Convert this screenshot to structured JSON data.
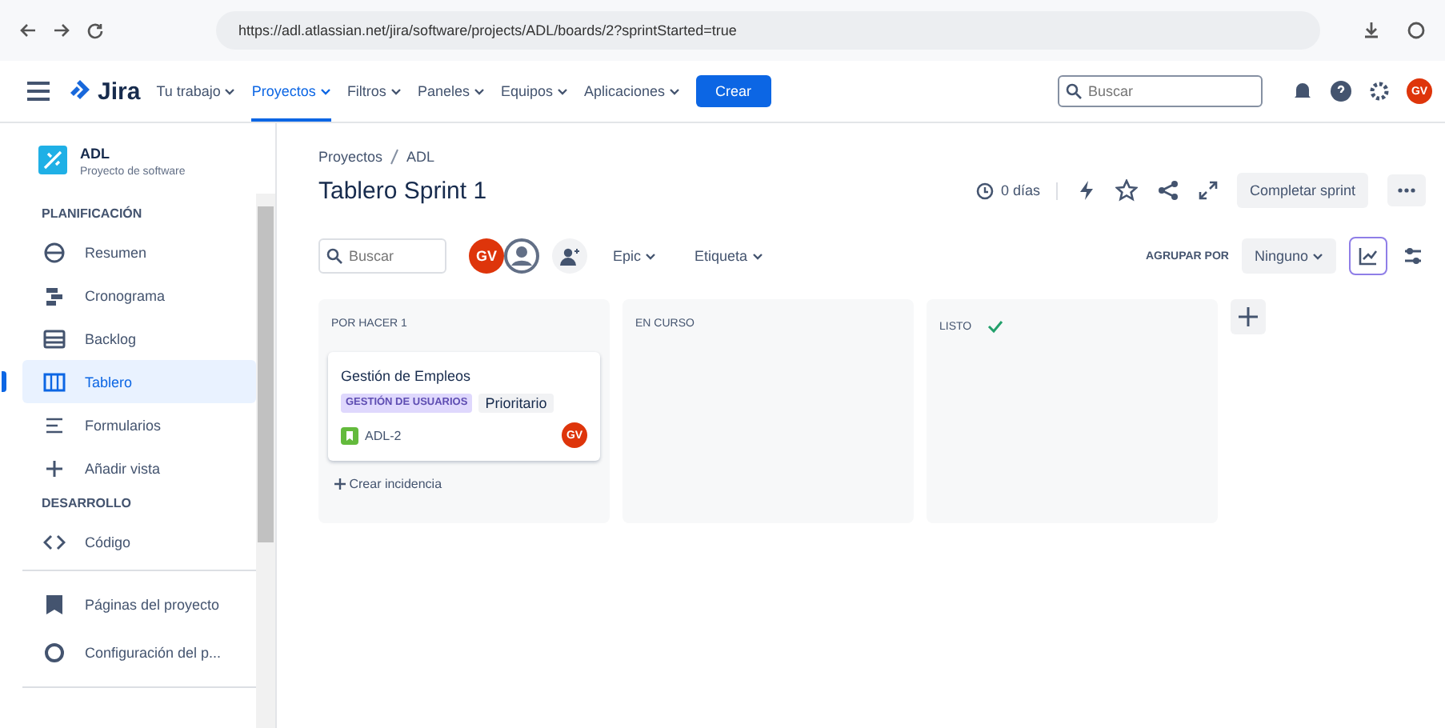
{
  "browser": {
    "url": "https://adl.atlassian.net/jira/software/projects/ADL/boards/2?sprintStarted=true"
  },
  "topnav": {
    "logo": "Jira",
    "items": [
      {
        "label": "Tu trabajo",
        "selected": false
      },
      {
        "label": "Proyectos",
        "selected": true
      },
      {
        "label": "Filtros",
        "selected": false
      },
      {
        "label": "Paneles",
        "selected": false
      },
      {
        "label": "Equipos",
        "selected": false
      },
      {
        "label": "Aplicaciones",
        "selected": false
      }
    ],
    "create": "Crear",
    "search": {
      "placeholder": "Buscar"
    },
    "avatar": "GV"
  },
  "project": {
    "name": "ADL",
    "type": "Proyecto de software"
  },
  "sidebar": {
    "sections": [
      {
        "title": "PLANIFICACIÓN",
        "items": [
          {
            "label": "Resumen",
            "selected": false
          },
          {
            "label": "Cronograma",
            "selected": false
          },
          {
            "label": "Backlog",
            "selected": false
          },
          {
            "label": "Tablero",
            "selected": true
          },
          {
            "label": "Formularios",
            "selected": false
          },
          {
            "label": "Añadir vista",
            "selected": false
          }
        ]
      },
      {
        "title": "DESARROLLO",
        "items": [
          {
            "label": "Código",
            "selected": false
          }
        ]
      }
    ],
    "footer": [
      {
        "label": "Páginas del proyecto"
      },
      {
        "label": "Configuración del p..."
      }
    ]
  },
  "breadcrumb": [
    "Proyectos",
    "ADL"
  ],
  "title": "Tablero Sprint 1",
  "days": "0 días",
  "complete": "Completar sprint",
  "filters": {
    "search": {
      "placeholder": "Buscar"
    },
    "avatar": "GV",
    "dropdowns": [
      "Epic",
      "Etiqueta"
    ],
    "group_label": "AGRUPAR POR",
    "group_value": "Ninguno"
  },
  "columns": [
    {
      "title": "POR HACER 1",
      "done": false,
      "cards": [
        {
          "title": "Gestión de Empleos",
          "epic": "GESTIÓN DE USUARIOS",
          "label": "Prioritario",
          "key": "ADL-2",
          "avatar": "GV"
        }
      ],
      "create": "Crear incidencia"
    },
    {
      "title": "EN CURSO",
      "done": false
    },
    {
      "title": "LISTO",
      "done": true
    }
  ]
}
